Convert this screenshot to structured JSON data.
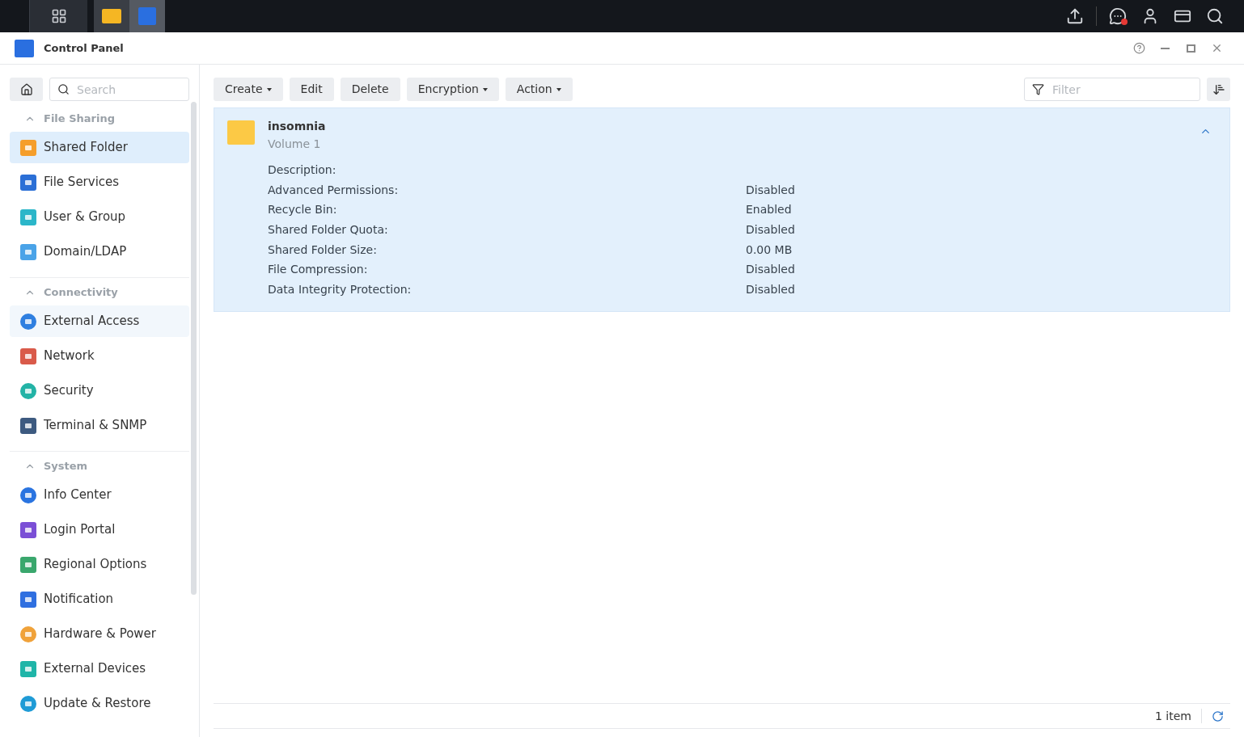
{
  "window": {
    "title": "Control Panel"
  },
  "sidebar": {
    "search": {
      "placeholder": "Search"
    },
    "sections": [
      {
        "title": "File Sharing",
        "expanded": true,
        "items": [
          {
            "label": "Shared Folder",
            "selected": true,
            "hovered": false
          },
          {
            "label": "File Services",
            "selected": false,
            "hovered": false
          },
          {
            "label": "User & Group",
            "selected": false,
            "hovered": false
          },
          {
            "label": "Domain/LDAP",
            "selected": false,
            "hovered": false
          }
        ]
      },
      {
        "title": "Connectivity",
        "expanded": true,
        "items": [
          {
            "label": "External Access",
            "selected": false,
            "hovered": true
          },
          {
            "label": "Network",
            "selected": false,
            "hovered": false
          },
          {
            "label": "Security",
            "selected": false,
            "hovered": false
          },
          {
            "label": "Terminal & SNMP",
            "selected": false,
            "hovered": false
          }
        ]
      },
      {
        "title": "System",
        "expanded": true,
        "items": [
          {
            "label": "Info Center",
            "selected": false,
            "hovered": false
          },
          {
            "label": "Login Portal",
            "selected": false,
            "hovered": false
          },
          {
            "label": "Regional Options",
            "selected": false,
            "hovered": false
          },
          {
            "label": "Notification",
            "selected": false,
            "hovered": false
          },
          {
            "label": "Hardware & Power",
            "selected": false,
            "hovered": false
          },
          {
            "label": "External Devices",
            "selected": false,
            "hovered": false
          },
          {
            "label": "Update & Restore",
            "selected": false,
            "hovered": false
          }
        ]
      }
    ]
  },
  "toolbar": {
    "buttons": [
      {
        "label": "Create",
        "dropdown": true
      },
      {
        "label": "Edit",
        "dropdown": false
      },
      {
        "label": "Delete",
        "dropdown": false
      },
      {
        "label": "Encryption",
        "dropdown": true
      },
      {
        "label": "Action",
        "dropdown": true
      }
    ],
    "filter": {
      "placeholder": "Filter"
    }
  },
  "folders": [
    {
      "name": "insomnia",
      "volume": "Volume 1",
      "expanded": true,
      "selected": true,
      "details": [
        {
          "label": "Description:"
        },
        {
          "label": "Advanced Permissions:",
          "value": "Disabled"
        },
        {
          "label": "Recycle Bin:",
          "value": "Enabled"
        },
        {
          "label": "Shared Folder Quota:",
          "value": "Disabled"
        },
        {
          "label": "Shared Folder Size:",
          "value": "0.00 MB"
        },
        {
          "label": "File Compression:",
          "value": "Disabled"
        },
        {
          "label": "Data Integrity Protection:",
          "value": "Disabled"
        }
      ]
    }
  ],
  "status_bar": {
    "count": "1 item"
  }
}
